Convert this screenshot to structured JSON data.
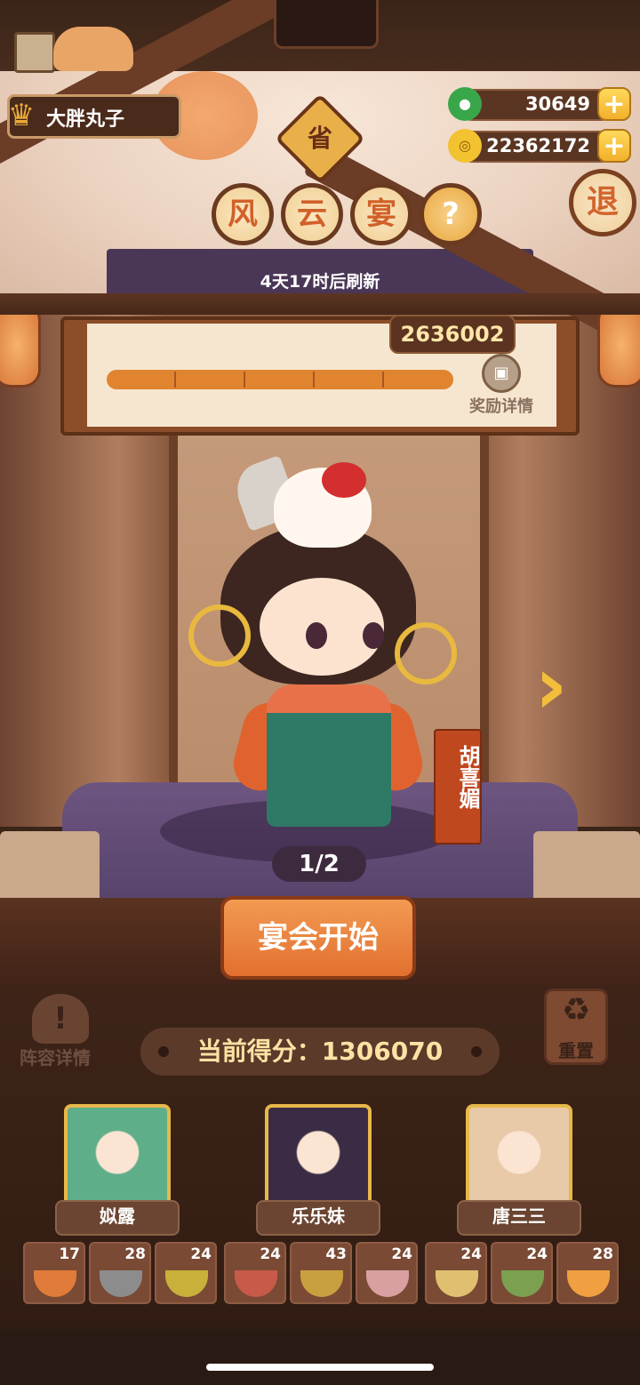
{
  "player": {
    "name": "大胖丸子"
  },
  "currency": {
    "jade": "30649",
    "coins": "22362172",
    "plus_label": "+"
  },
  "exit_label": "退",
  "province_badge": "省",
  "title_chars": [
    "风",
    "云",
    "宴"
  ],
  "help_label": "?",
  "refresh_text": "4天17时后刷新",
  "progress": {
    "target_score": "2636002",
    "reward_label": "奖励详情",
    "fill_fraction": 1.0
  },
  "character": {
    "name": "胡喜媚",
    "page": "1/2"
  },
  "start_button": "宴会开始",
  "lineup_label": "阵容详情",
  "reset_label": "重置",
  "current_score": "当前得分：1306070",
  "heroes": [
    {
      "name": "姒露",
      "color": "#5fae8a"
    },
    {
      "name": "乐乐妹",
      "color": "#3a2c44"
    },
    {
      "name": "唐三三",
      "color": "#e8c9a8"
    }
  ],
  "dishes": [
    {
      "count": "17",
      "color": "#e07b3a"
    },
    {
      "count": "28",
      "color": "#8c8c8c"
    },
    {
      "count": "24",
      "color": "#c8b03a"
    },
    {
      "count": "24",
      "color": "#c85a4a"
    },
    {
      "count": "43",
      "color": "#c9a040"
    },
    {
      "count": "24",
      "color": "#d8a0a0"
    },
    {
      "count": "24",
      "color": "#e0c070"
    },
    {
      "count": "24",
      "color": "#7aa050"
    },
    {
      "count": "28",
      "color": "#f0a040"
    }
  ]
}
